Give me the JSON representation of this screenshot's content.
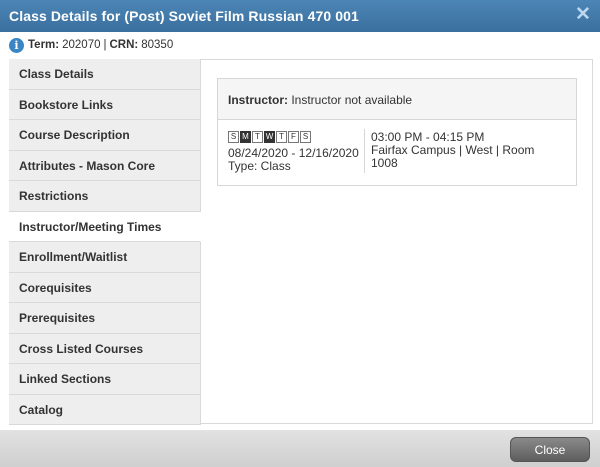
{
  "dialog": {
    "title": "Class Details for (Post) Soviet Film Russian 470 001",
    "close_glyph": "✕"
  },
  "term": {
    "term_label": "Term:",
    "term_value": "202070",
    "separator": "|",
    "crn_label": "CRN:",
    "crn_value": "80350"
  },
  "sidebar": {
    "items": [
      {
        "label": "Class Details"
      },
      {
        "label": "Bookstore Links"
      },
      {
        "label": "Course Description"
      },
      {
        "label": "Attributes - Mason Core"
      },
      {
        "label": "Restrictions"
      },
      {
        "label": "Instructor/Meeting Times",
        "active": true
      },
      {
        "label": "Enrollment/Waitlist"
      },
      {
        "label": "Corequisites"
      },
      {
        "label": "Prerequisites"
      },
      {
        "label": "Cross Listed Courses"
      },
      {
        "label": "Linked Sections"
      },
      {
        "label": "Catalog"
      }
    ]
  },
  "meeting": {
    "instructor_label": "Instructor:",
    "instructor_value": "Instructor not available",
    "days": [
      {
        "letter": "S",
        "on": false
      },
      {
        "letter": "M",
        "on": true
      },
      {
        "letter": "T",
        "on": false
      },
      {
        "letter": "W",
        "on": true
      },
      {
        "letter": "T",
        "on": false
      },
      {
        "letter": "F",
        "on": false
      },
      {
        "letter": "S",
        "on": false
      }
    ],
    "dates": "08/24/2020 - 12/16/2020",
    "type": "Type: Class",
    "time": "03:00 PM - 04:15 PM",
    "location": "Fairfax Campus | West | Room 1008"
  },
  "footer": {
    "close_label": "Close"
  }
}
